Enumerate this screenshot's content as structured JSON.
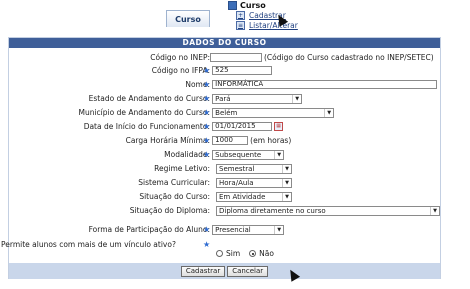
{
  "menu": {
    "tab_label": "Curso",
    "root_label": "Curso",
    "items": [
      {
        "label": "Cadastrar"
      },
      {
        "label": "Listar/Alterar"
      }
    ]
  },
  "form": {
    "caption": "Dados do Curso",
    "fields": {
      "codigo_inep": {
        "label": "Código no INEP:",
        "value": "",
        "note": "(Código do Curso cadastrado no INEP/SETEC)"
      },
      "codigo_ifpa": {
        "label": "Código no IFPA:",
        "value": "525"
      },
      "nome": {
        "label": "Nome:",
        "value": "INFORMÁTICA"
      },
      "estado": {
        "label": "Estado de Andamento do Curso:",
        "value": "Pará"
      },
      "municipio": {
        "label": "Município de Andamento do Curso:",
        "value": "Belém"
      },
      "data_inicio": {
        "label": "Data de Início do Funcionamento:",
        "value": "01/01/2015"
      },
      "carga": {
        "label": "Carga Horária Mínima:",
        "value": "1000",
        "unit": "(em horas)"
      },
      "modalidade": {
        "label": "Modalidade:",
        "value": "Subsequente"
      },
      "regime": {
        "label": "Regime Letivo:",
        "value": "Semestral"
      },
      "sistema": {
        "label": "Sistema Curricular:",
        "value": "Hora/Aula"
      },
      "situacao_curso": {
        "label": "Situação do Curso:",
        "value": "Em Atividade"
      },
      "situacao_diploma": {
        "label": "Situação do Diploma:",
        "value": "Diploma diretamente no curso"
      },
      "forma_participacao": {
        "label": "Forma de Participação do Aluno:",
        "value": "Presencial"
      },
      "vinculo": {
        "label": "Permite alunos com mais de um vínculo ativo?",
        "option_sim": "Sim",
        "option_nao": "Não",
        "selected": "Não"
      }
    },
    "buttons": {
      "submit": "Cadastrar",
      "cancel": "Cancelar"
    }
  },
  "colors": {
    "caption_bg": "#3f5f99",
    "footer_bg": "#c9d6ea",
    "required_star": "#2e6bd1"
  }
}
